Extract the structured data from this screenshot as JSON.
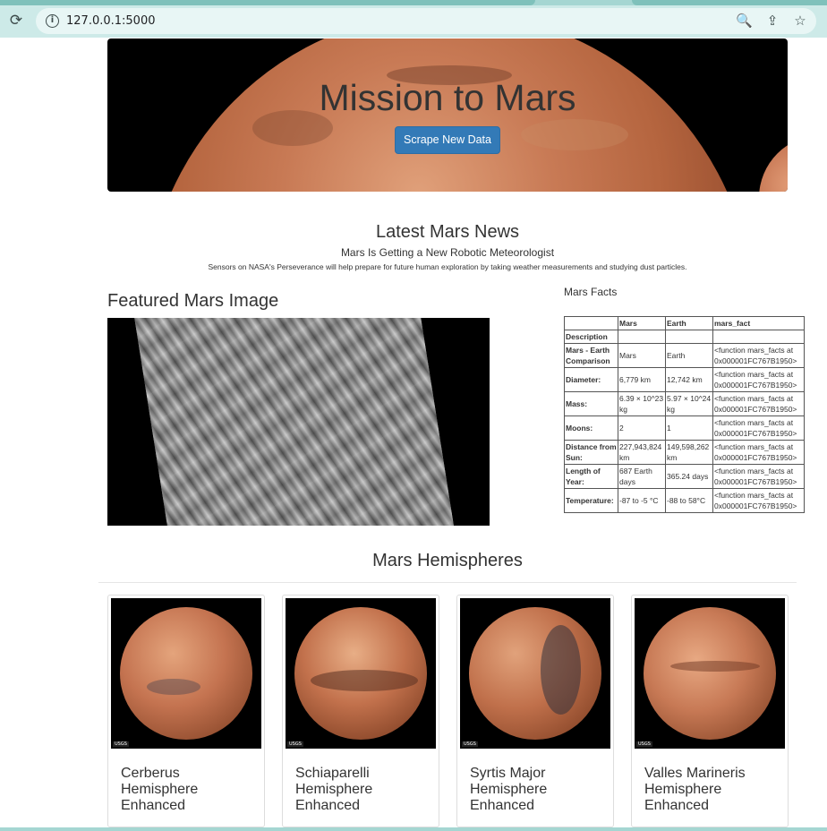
{
  "browser": {
    "url": "127.0.0.1:5000",
    "reload_icon": "⟳",
    "info_icon": "i",
    "zoom_icon": "🔍",
    "share_icon": "⇪",
    "star_icon": "☆"
  },
  "jumbotron": {
    "title": "Mission to Mars",
    "button_label": "Scrape New Data",
    "button_color": "#337ab7"
  },
  "news": {
    "section_title": "Latest Mars News",
    "headline": "Mars Is Getting a New Robotic Meteorologist",
    "teaser": "Sensors on NASA's Perseverance will help prepare for future human exploration by taking weather measurements and studying dust particles."
  },
  "featured": {
    "title": "Featured Mars Image"
  },
  "facts": {
    "title": "Mars Facts",
    "headers": [
      "",
      "Mars",
      "Earth",
      "mars_fact"
    ],
    "index_header": "Description",
    "rows": [
      {
        "label": "Mars - Earth Comparison",
        "mars": "Mars",
        "earth": "Earth",
        "fact": "<function mars_facts at 0x000001FC767B1950>"
      },
      {
        "label": "Diameter:",
        "mars": "6,779 km",
        "earth": "12,742 km",
        "fact": "<function mars_facts at 0x000001FC767B1950>"
      },
      {
        "label": "Mass:",
        "mars": "6.39 × 10^23 kg",
        "earth": "5.97 × 10^24 kg",
        "fact": "<function mars_facts at 0x000001FC767B1950>"
      },
      {
        "label": "Moons:",
        "mars": "2",
        "earth": "1",
        "fact": "<function mars_facts at 0x000001FC767B1950>"
      },
      {
        "label": "Distance from Sun:",
        "mars": "227,943,824 km",
        "earth": "149,598,262 km",
        "fact": "<function mars_facts at 0x000001FC767B1950>"
      },
      {
        "label": "Length of Year:",
        "mars": "687 Earth days",
        "earth": "365.24 days",
        "fact": "<function mars_facts at 0x000001FC767B1950>"
      },
      {
        "label": "Temperature:",
        "mars": "-87 to -5 °C",
        "earth": "-88 to 58°C",
        "fact": "<function mars_facts at 0x000001FC767B1950>"
      }
    ]
  },
  "hemispheres": {
    "title": "Mars Hemispheres",
    "items": [
      {
        "label": "Cerberus Hemisphere Enhanced"
      },
      {
        "label": "Schiaparelli Hemisphere Enhanced"
      },
      {
        "label": "Syrtis Major Hemisphere Enhanced"
      },
      {
        "label": "Valles Marineris Hemisphere Enhanced"
      }
    ]
  }
}
